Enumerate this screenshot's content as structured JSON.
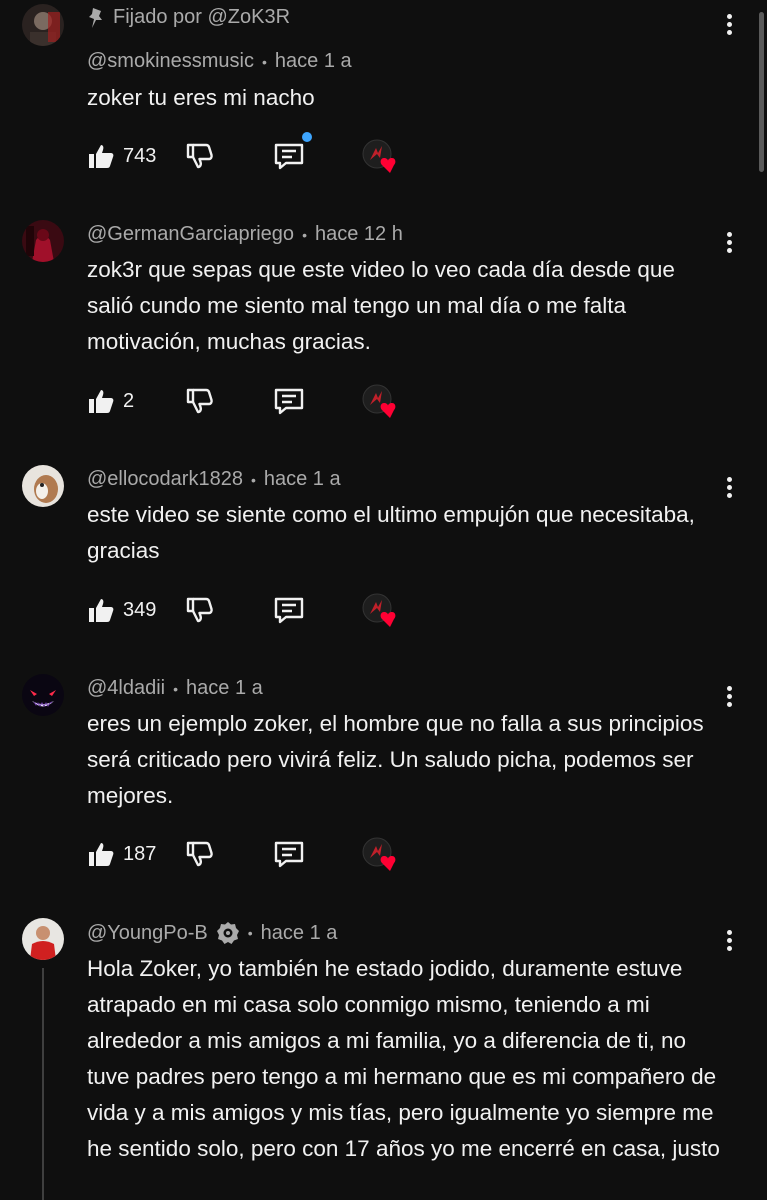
{
  "comments": [
    {
      "pinned_text": "Fijado por @ZoK3R",
      "author": "@smokinessmusic",
      "time": "hace 1 a",
      "text": "zoker tu eres mi nacho",
      "likes": "743",
      "reply_new": true
    },
    {
      "author": "@GermanGarciapriego",
      "time": "hace 12 h",
      "text": "zok3r que sepas que este video lo veo cada día desde que salió cundo me siento mal tengo un mal día o me falta motivación, muchas gracias.",
      "likes": "2"
    },
    {
      "author": "@ellocodark1828",
      "time": "hace 1 a",
      "text": "este video se siente como el ultimo empujón que necesitaba, gracias",
      "likes": "349"
    },
    {
      "author": "@4ldadii",
      "time": "hace 1 a",
      "text": "eres un ejemplo zoker, el hombre que no falla a sus principios será criticado pero vivirá feliz. Un saludo picha, podemos ser mejores.",
      "likes": "187"
    },
    {
      "author": "@YoungPo-B",
      "time": "hace 1 a",
      "verified_icon": "verified-badge-icon",
      "text": "Hola Zoker, yo también he estado jodido, duramente estuve atrapado en mi casa solo conmigo mismo, teniendo a mi alrededor a mis amigos a mi familia, yo a diferencia de ti, no tuve padres pero tengo a mi hermano que es mi compañero de vida y a mis amigos y mis tías, pero igualmente yo siempre me he sentido solo, pero con 17 años yo me encerré en casa, justo"
    }
  ],
  "icons": {
    "like": "thumbs-up-icon",
    "dislike": "thumbs-down-icon",
    "reply": "reply-comment-icon",
    "creator_heart": "creator-heart-icon",
    "more": "more-vert-icon",
    "pin": "pin-icon"
  },
  "colors": {
    "background": "#0f0f0f",
    "text": "#f1f1f1",
    "secondary": "#aaaaaa",
    "heart": "#ff0033",
    "new_dot": "#3ea6ff"
  }
}
